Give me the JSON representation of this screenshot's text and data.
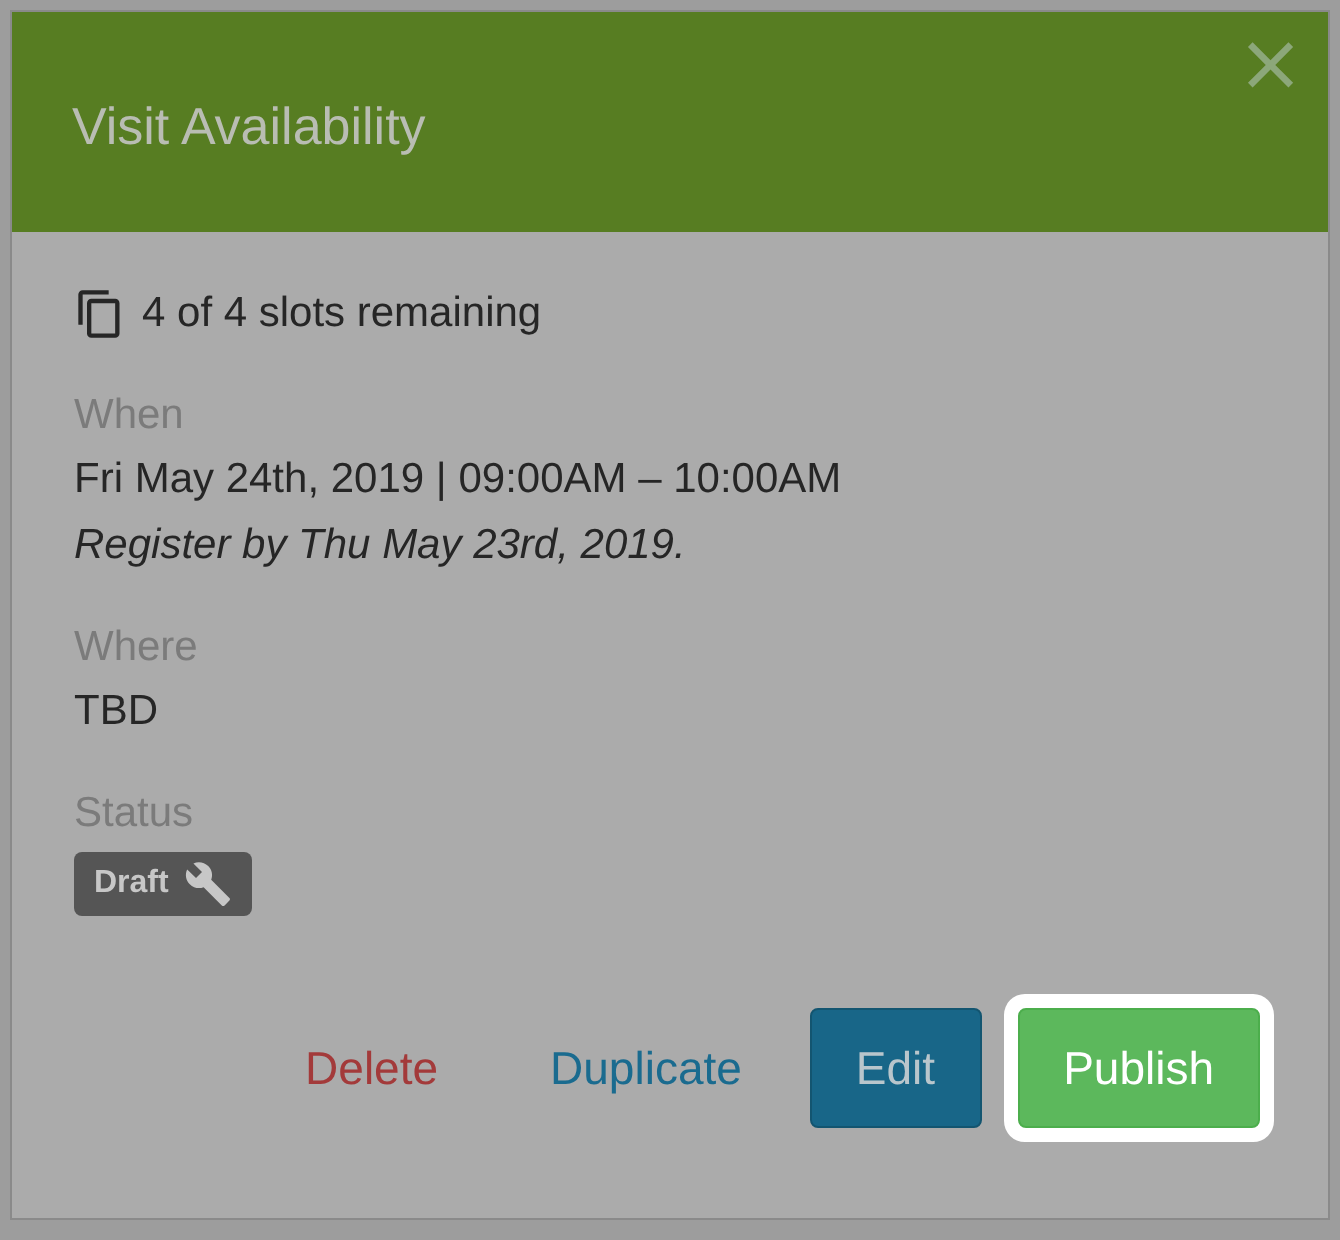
{
  "dialog": {
    "title": "Visit Availability",
    "close": "×"
  },
  "slots": "4 of 4 slots remaining",
  "sections": [
    {
      "label": "When",
      "lines": [
        {
          "text": "Fri May 24th, 2019 | 09:00AM – 10:00AM",
          "italic": false
        },
        {
          "text": "Register by Thu May 23rd, 2019.",
          "italic": true
        }
      ]
    },
    {
      "label": "Where",
      "lines": [
        {
          "text": "TBD",
          "italic": false
        }
      ]
    }
  ],
  "status": {
    "label": "Status",
    "badge": "Draft"
  },
  "buttons": [
    {
      "label": "Delete",
      "kind": "danger-link",
      "highlighted": false
    },
    {
      "label": "Duplicate",
      "kind": "link",
      "highlighted": false
    },
    {
      "label": "Edit",
      "kind": "primary",
      "highlighted": false
    },
    {
      "label": "Publish",
      "kind": "success",
      "highlighted": true
    }
  ]
}
